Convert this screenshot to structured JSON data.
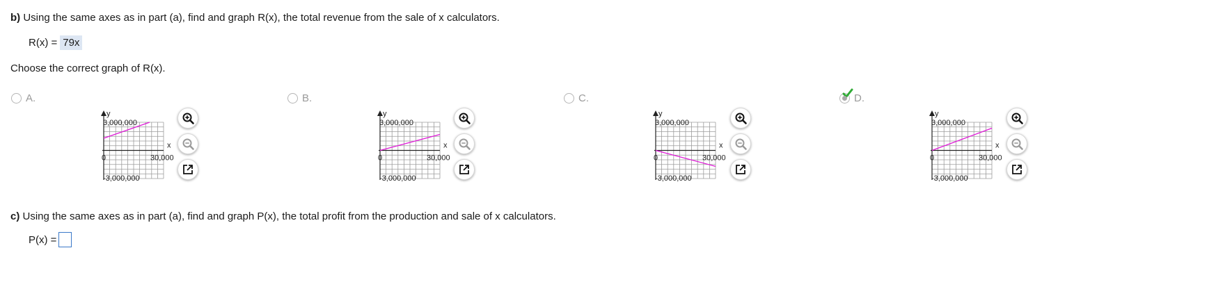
{
  "part_b": {
    "label": "b)",
    "question": "Using the same axes as in part (a), find and graph R(x), the total revenue from the sale of x calculators.",
    "answer_prefix": "R(x) =",
    "answer_value": "79x",
    "instruction": "Choose the correct graph of R(x)."
  },
  "options": [
    {
      "letter": "A.",
      "selected": false,
      "line": {
        "from": [
          0,
          1300000
        ],
        "to": [
          23000,
          3000000
        ]
      }
    },
    {
      "letter": "B.",
      "selected": false,
      "line": {
        "from": [
          0,
          0
        ],
        "to": [
          30000,
          1700000
        ]
      }
    },
    {
      "letter": "C.",
      "selected": false,
      "line": {
        "from": [
          0,
          0
        ],
        "to": [
          30000,
          -1700000
        ]
      }
    },
    {
      "letter": "D.",
      "selected": true,
      "line": {
        "from": [
          0,
          0
        ],
        "to": [
          30000,
          2370000
        ]
      }
    }
  ],
  "graph_labels": {
    "y_axis": "y",
    "x_axis": "x",
    "y_max": "3,000,000",
    "y_min": "-3,000,000",
    "x_max": "30,000",
    "origin": "0"
  },
  "graph_axes": {
    "xlim": [
      0,
      30000
    ],
    "ylim": [
      -3000000,
      3000000
    ]
  },
  "colors": {
    "line": "#e01ad8",
    "check": "#2eaa34",
    "accent": "#3a78c9"
  },
  "icons": {
    "zoom_in": "zoom-in-icon",
    "zoom_out": "zoom-out-icon",
    "popout": "popout-icon"
  },
  "part_c": {
    "label": "c)",
    "question": "Using the same axes as in part (a), find and graph P(x), the total profit from the production and sale of x calculators.",
    "answer_prefix": "P(x) ="
  }
}
